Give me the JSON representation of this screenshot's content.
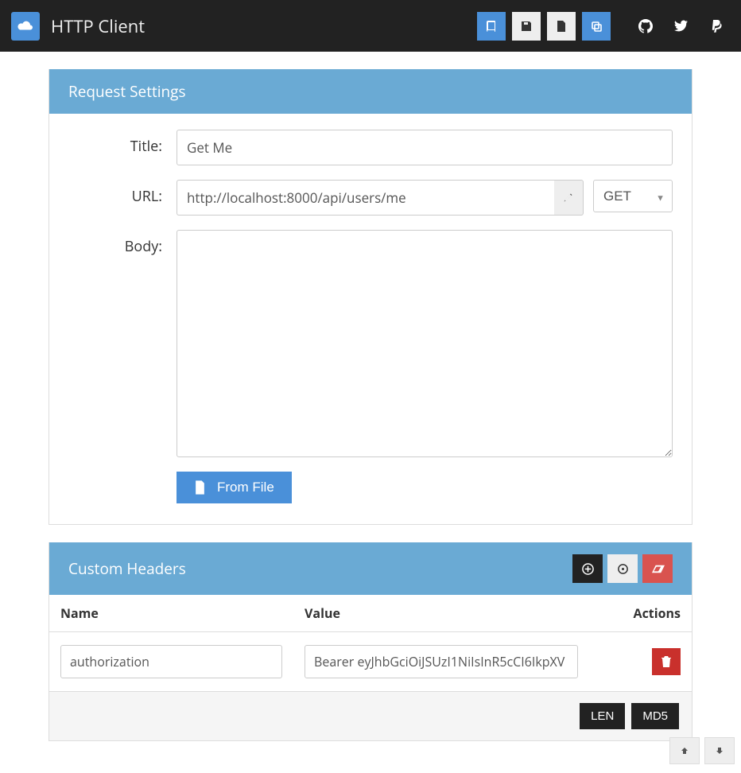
{
  "navbar": {
    "title": "HTTP Client"
  },
  "request_settings": {
    "heading": "Request Settings",
    "title_label": "Title:",
    "title_value": "Get Me",
    "url_label": "URL:",
    "url_value": "http://localhost:8000/api/users/me",
    "method_selected": "GET",
    "body_label": "Body:",
    "body_value": "",
    "from_file_label": "From File"
  },
  "custom_headers": {
    "heading": "Custom Headers",
    "columns": {
      "name": "Name",
      "value": "Value",
      "actions": "Actions"
    },
    "rows": [
      {
        "name": "authorization",
        "value": "Bearer eyJhbGciOiJSUzI1NiIsInR5cCI6IkpXV"
      }
    ],
    "footer": {
      "len": "LEN",
      "md5": "MD5"
    }
  }
}
